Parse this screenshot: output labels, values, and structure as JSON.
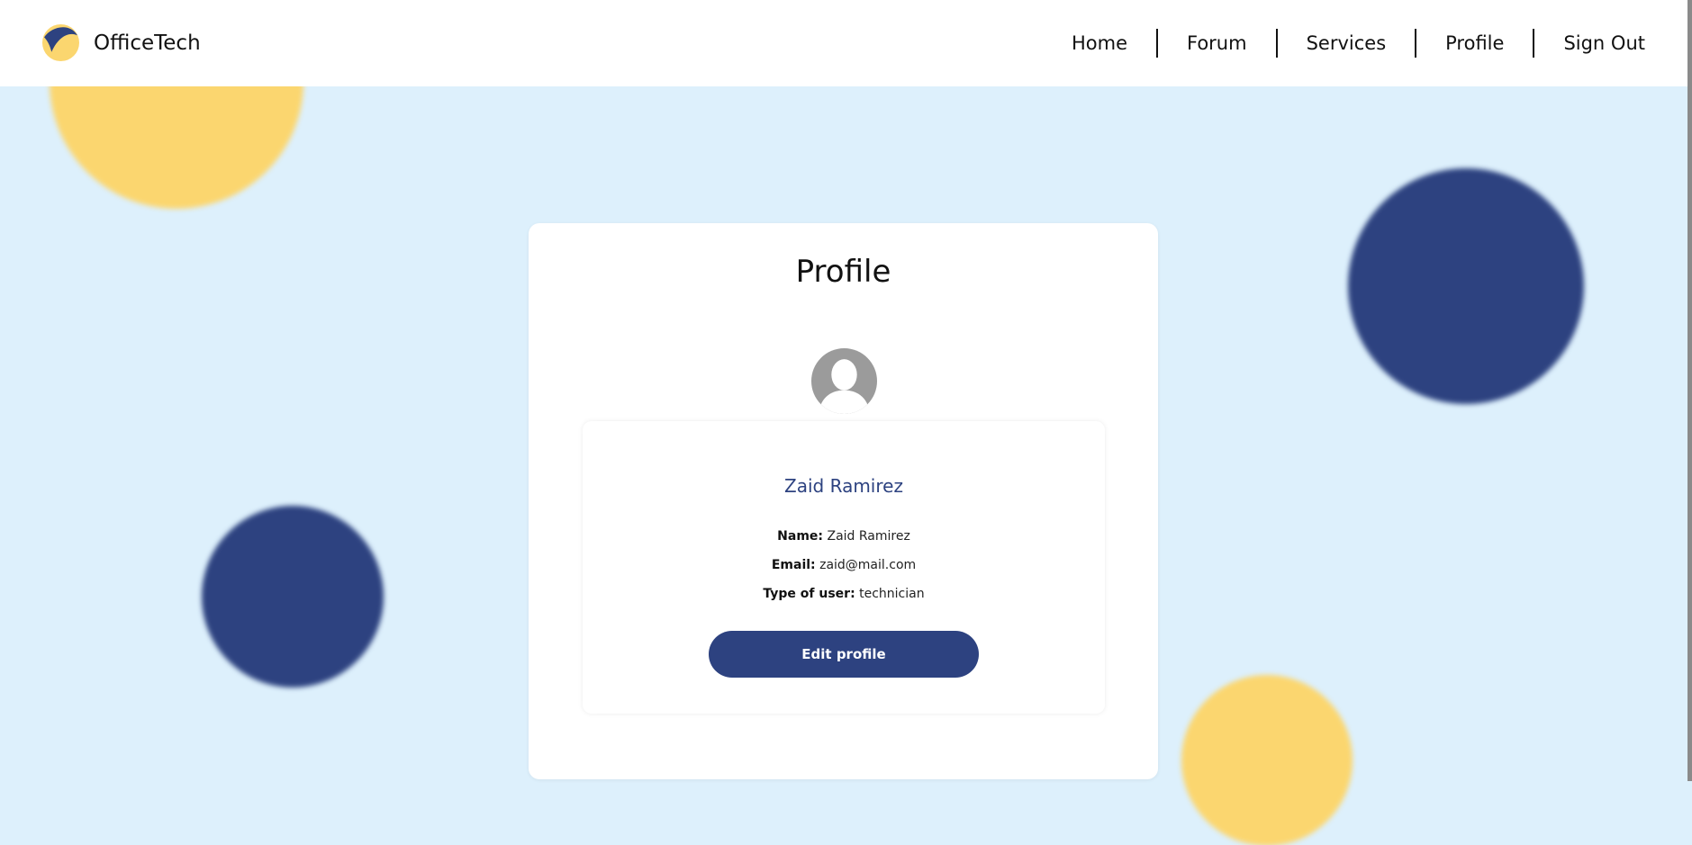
{
  "header": {
    "brand_name": "OfficeTech",
    "logo_icon": "officetech-logo-icon",
    "nav": [
      {
        "label": "Home"
      },
      {
        "label": "Forum"
      },
      {
        "label": "Services"
      },
      {
        "label": "Profile"
      },
      {
        "label": "Sign Out"
      }
    ]
  },
  "profile": {
    "title": "Profile",
    "avatar_icon": "user-avatar-icon",
    "display_name": "Zaid Ramirez",
    "fields": {
      "name_label": "Name:",
      "name_value": "Zaid Ramirez",
      "email_label": "Email:",
      "email_value": "zaid@mail.com",
      "type_label": "Type of user:",
      "type_value": "technician"
    },
    "edit_button_label": "Edit profile"
  },
  "colors": {
    "background": "#ddf0fc",
    "accent_navy": "#2d4280",
    "accent_yellow": "#fbd66f"
  }
}
